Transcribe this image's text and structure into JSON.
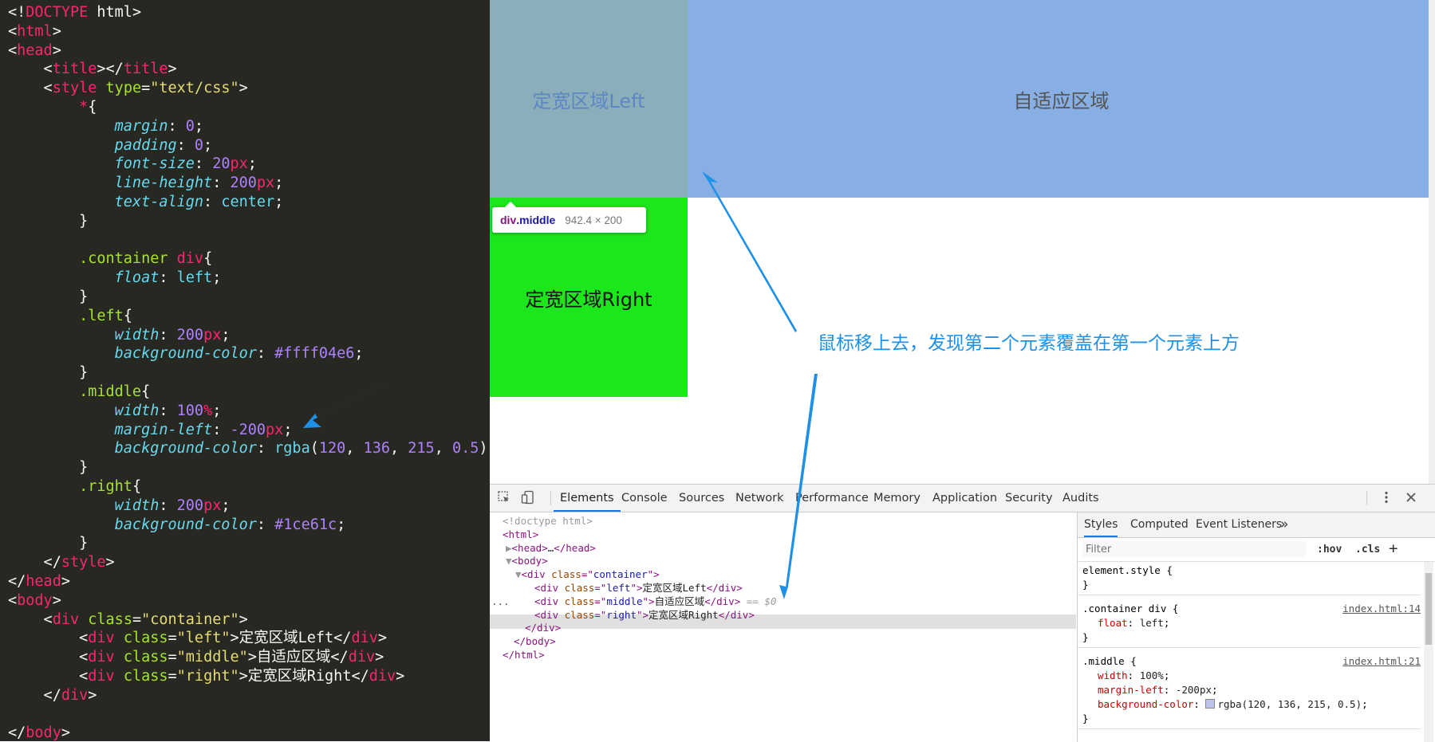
{
  "editor": {
    "lines": [
      [
        [
          "t-p",
          "<!"
        ],
        [
          "t-tag",
          "DOCTYPE"
        ],
        [
          "t-p",
          " html>"
        ]
      ],
      [
        [
          "t-p",
          "<"
        ],
        [
          "t-tag",
          "html"
        ],
        [
          "t-p",
          ">"
        ]
      ],
      [
        [
          "t-p",
          "<"
        ],
        [
          "t-tag",
          "head"
        ],
        [
          "t-p",
          ">"
        ]
      ],
      [
        [
          "t-p",
          "    <"
        ],
        [
          "t-tag",
          "title"
        ],
        [
          "t-p",
          "></"
        ],
        [
          "t-tag",
          "title"
        ],
        [
          "t-p",
          ">"
        ]
      ],
      [
        [
          "t-p",
          "    <"
        ],
        [
          "t-tag",
          "style"
        ],
        [
          "t-p",
          " "
        ],
        [
          "t-attr",
          "type"
        ],
        [
          "t-p",
          "="
        ],
        [
          "t-str",
          "\"text/css\""
        ],
        [
          "t-p",
          ">"
        ]
      ],
      [
        [
          "t-p",
          "        "
        ],
        [
          "t-tag",
          "*"
        ],
        [
          "t-p",
          "{"
        ]
      ],
      [
        [
          "t-p",
          "            "
        ],
        [
          "t-prop",
          "margin"
        ],
        [
          "t-p",
          ": "
        ],
        [
          "t-num",
          "0"
        ],
        [
          "t-p",
          ";"
        ]
      ],
      [
        [
          "t-p",
          "            "
        ],
        [
          "t-prop",
          "padding"
        ],
        [
          "t-p",
          ": "
        ],
        [
          "t-num",
          "0"
        ],
        [
          "t-p",
          ";"
        ]
      ],
      [
        [
          "t-p",
          "            "
        ],
        [
          "t-prop",
          "font-size"
        ],
        [
          "t-p",
          ": "
        ],
        [
          "t-num",
          "20"
        ],
        [
          "t-tag",
          "px"
        ],
        [
          "t-p",
          ";"
        ]
      ],
      [
        [
          "t-p",
          "            "
        ],
        [
          "t-prop",
          "line-height"
        ],
        [
          "t-p",
          ": "
        ],
        [
          "t-num",
          "200"
        ],
        [
          "t-tag",
          "px"
        ],
        [
          "t-p",
          ";"
        ]
      ],
      [
        [
          "t-p",
          "            "
        ],
        [
          "t-prop",
          "text-align"
        ],
        [
          "t-p",
          ": "
        ],
        [
          "t-kw",
          "center"
        ],
        [
          "t-p",
          ";"
        ]
      ],
      [
        [
          "t-p",
          "        }"
        ]
      ],
      [
        [
          "t-p",
          ""
        ]
      ],
      [
        [
          "t-p",
          "        "
        ],
        [
          "t-sel",
          ".container"
        ],
        [
          "t-p",
          " "
        ],
        [
          "t-tag",
          "div"
        ],
        [
          "t-p",
          "{"
        ]
      ],
      [
        [
          "t-p",
          "            "
        ],
        [
          "t-prop",
          "float"
        ],
        [
          "t-p",
          ": "
        ],
        [
          "t-kw",
          "left"
        ],
        [
          "t-p",
          ";"
        ]
      ],
      [
        [
          "t-p",
          "        }"
        ]
      ],
      [
        [
          "t-p",
          "        "
        ],
        [
          "t-sel",
          ".left"
        ],
        [
          "t-p",
          "{"
        ]
      ],
      [
        [
          "t-p",
          "            "
        ],
        [
          "t-prop",
          "width"
        ],
        [
          "t-p",
          ": "
        ],
        [
          "t-num",
          "200"
        ],
        [
          "t-tag",
          "px"
        ],
        [
          "t-p",
          ";"
        ]
      ],
      [
        [
          "t-p",
          "            "
        ],
        [
          "t-prop",
          "background-color"
        ],
        [
          "t-p",
          ": "
        ],
        [
          "t-num",
          "#ffff04e6"
        ],
        [
          "t-p",
          ";"
        ]
      ],
      [
        [
          "t-p",
          "        }"
        ]
      ],
      [
        [
          "t-p",
          "        "
        ],
        [
          "t-sel",
          ".middle"
        ],
        [
          "t-p",
          "{"
        ]
      ],
      [
        [
          "t-p",
          "            "
        ],
        [
          "t-prop",
          "width"
        ],
        [
          "t-p",
          ": "
        ],
        [
          "t-num",
          "100"
        ],
        [
          "t-tag",
          "%"
        ],
        [
          "t-p",
          ";"
        ]
      ],
      [
        [
          "t-p",
          "            "
        ],
        [
          "t-prop",
          "margin-left"
        ],
        [
          "t-p",
          ": "
        ],
        [
          "t-num",
          "-200"
        ],
        [
          "t-tag",
          "px"
        ],
        [
          "t-p",
          ";"
        ]
      ],
      [
        [
          "t-p",
          "            "
        ],
        [
          "t-prop",
          "background-color"
        ],
        [
          "t-p",
          ": "
        ],
        [
          "t-kw",
          "rgba"
        ],
        [
          "t-p",
          "("
        ],
        [
          "t-num",
          "120"
        ],
        [
          "t-p",
          ", "
        ],
        [
          "t-num",
          "136"
        ],
        [
          "t-p",
          ", "
        ],
        [
          "t-num",
          "215"
        ],
        [
          "t-p",
          ", "
        ],
        [
          "t-num",
          "0.5"
        ],
        [
          "t-p",
          ");"
        ]
      ],
      [
        [
          "t-p",
          "        }"
        ]
      ],
      [
        [
          "t-p",
          "        "
        ],
        [
          "t-sel",
          ".right"
        ],
        [
          "t-p",
          "{"
        ]
      ],
      [
        [
          "t-p",
          "            "
        ],
        [
          "t-prop",
          "width"
        ],
        [
          "t-p",
          ": "
        ],
        [
          "t-num",
          "200"
        ],
        [
          "t-tag",
          "px"
        ],
        [
          "t-p",
          ";"
        ]
      ],
      [
        [
          "t-p",
          "            "
        ],
        [
          "t-prop",
          "background-color"
        ],
        [
          "t-p",
          ": "
        ],
        [
          "t-num",
          "#1ce61c"
        ],
        [
          "t-p",
          ";"
        ]
      ],
      [
        [
          "t-p",
          "        }"
        ]
      ],
      [
        [
          "t-p",
          "    </"
        ],
        [
          "t-tag",
          "style"
        ],
        [
          "t-p",
          ">"
        ]
      ],
      [
        [
          "t-p",
          "</"
        ],
        [
          "t-tag",
          "head"
        ],
        [
          "t-p",
          ">"
        ]
      ],
      [
        [
          "t-p",
          "<"
        ],
        [
          "t-tag",
          "body"
        ],
        [
          "t-p",
          ">"
        ]
      ],
      [
        [
          "t-p",
          "    <"
        ],
        [
          "t-tag",
          "div"
        ],
        [
          "t-p",
          " "
        ],
        [
          "t-attr",
          "class"
        ],
        [
          "t-p",
          "="
        ],
        [
          "t-str",
          "\"container\""
        ],
        [
          "t-p",
          ">"
        ]
      ],
      [
        [
          "t-p",
          "        <"
        ],
        [
          "t-tag",
          "div"
        ],
        [
          "t-p",
          " "
        ],
        [
          "t-attr",
          "class"
        ],
        [
          "t-p",
          "="
        ],
        [
          "t-str",
          "\"left\""
        ],
        [
          "t-p",
          ">定宽区域Left</"
        ],
        [
          "t-tag",
          "div"
        ],
        [
          "t-p",
          ">"
        ]
      ],
      [
        [
          "t-p",
          "        <"
        ],
        [
          "t-tag",
          "div"
        ],
        [
          "t-p",
          " "
        ],
        [
          "t-attr",
          "class"
        ],
        [
          "t-p",
          "="
        ],
        [
          "t-str",
          "\"middle\""
        ],
        [
          "t-p",
          ">自适应区域</"
        ],
        [
          "t-tag",
          "div"
        ],
        [
          "t-p",
          ">"
        ]
      ],
      [
        [
          "t-p",
          "        <"
        ],
        [
          "t-tag",
          "div"
        ],
        [
          "t-p",
          " "
        ],
        [
          "t-attr",
          "class"
        ],
        [
          "t-p",
          "="
        ],
        [
          "t-str",
          "\"right\""
        ],
        [
          "t-p",
          ">定宽区域Right</"
        ],
        [
          "t-tag",
          "div"
        ],
        [
          "t-p",
          ">"
        ]
      ],
      [
        [
          "t-p",
          "    </"
        ],
        [
          "t-tag",
          "div"
        ],
        [
          "t-p",
          ">"
        ]
      ],
      [
        [
          "t-p",
          ""
        ]
      ],
      [
        [
          "t-p",
          "</"
        ],
        [
          "t-tag",
          "body"
        ],
        [
          "t-p",
          ">"
        ]
      ]
    ]
  },
  "preview": {
    "left_label": "定宽区域Left",
    "middle_label": "自适应区域",
    "right_label": "定宽区域Right",
    "tooltip_tag": "div",
    "tooltip_class": ".middle",
    "tooltip_size": "942.4 × 200",
    "annotation": "鼠标移上去，发现第二个元素覆盖在第一个元素上方",
    "colors": {
      "left": "#8aafba",
      "middle": "#87afe3",
      "right": "#1ce61c",
      "annotation": "#1e90e8"
    }
  },
  "devtools": {
    "tabs": [
      "Elements",
      "Console",
      "Sources",
      "Network",
      "Performance",
      "Memory",
      "Application",
      "Security",
      "Audits"
    ],
    "active_tab": "Elements",
    "icons": [
      "inspect-icon",
      "device-toggle-icon",
      "more-vert-icon",
      "close-icon"
    ],
    "dom": [
      [
        [
          "c-gray",
          "<!doctype html>"
        ]
      ],
      [
        [
          "c-tag",
          "<html>"
        ]
      ],
      [
        [
          "c-gray",
          "▶"
        ],
        [
          "c-tag",
          "<head>"
        ],
        [
          "c-txt",
          "…"
        ],
        [
          "c-tag",
          "</head>"
        ]
      ],
      [
        [
          "c-gray",
          "▼"
        ],
        [
          "c-tag",
          "<body>"
        ]
      ],
      [
        [
          "c-gray",
          "▼"
        ],
        [
          "c-tag",
          "<div "
        ],
        [
          "c-attr",
          "class"
        ],
        [
          "c-tag",
          "=\""
        ],
        [
          "c-val",
          "container"
        ],
        [
          "c-tag",
          "\">"
        ]
      ],
      [
        [
          "c-tag",
          "<div "
        ],
        [
          "c-attr",
          "class"
        ],
        [
          "c-tag",
          "=\""
        ],
        [
          "c-val",
          "left"
        ],
        [
          "c-tag",
          "\">"
        ],
        [
          "c-txt",
          "定宽区域Left"
        ],
        [
          "c-tag",
          "</div>"
        ]
      ],
      [
        [
          "c-tag",
          "<div "
        ],
        [
          "c-attr",
          "class"
        ],
        [
          "c-tag",
          "=\""
        ],
        [
          "c-val",
          "middle"
        ],
        [
          "c-tag",
          "\">"
        ],
        [
          "c-txt",
          "自适应区域"
        ],
        [
          "c-tag",
          "</div>"
        ],
        [
          "c-com",
          " == $0"
        ]
      ],
      [
        [
          "c-tag",
          "<div "
        ],
        [
          "c-attr",
          "class"
        ],
        [
          "c-tag",
          "=\""
        ],
        [
          "c-val",
          "right"
        ],
        [
          "c-tag",
          "\">"
        ],
        [
          "c-txt",
          "定宽区域Right"
        ],
        [
          "c-tag",
          "</div>"
        ]
      ],
      [
        [
          "c-tag",
          "</div>"
        ]
      ],
      [
        [
          "c-tag",
          "</body>"
        ]
      ],
      [
        [
          "c-tag",
          "</html>"
        ]
      ]
    ],
    "selected_dots": "...",
    "styles_tabs": [
      "Styles",
      "Computed",
      "Event Listeners"
    ],
    "styles_more": "»",
    "filter_placeholder": "Filter",
    "hov": ":hov",
    "cls": ".cls",
    "plus": "+",
    "rules": [
      {
        "selector": "element.style {",
        "source": "",
        "props": [],
        "close": "}"
      },
      {
        "selector": ".container div {",
        "source": "index.html:14",
        "props": [
          [
            "float",
            "left"
          ]
        ],
        "close": "}"
      },
      {
        "selector": ".middle {",
        "source": "index.html:21",
        "props": [
          [
            "width",
            "100%"
          ],
          [
            "margin-left",
            "-200px"
          ],
          [
            "background-color",
            "rgba(120, 136, 215, 0.5)"
          ]
        ],
        "close": "}"
      }
    ]
  }
}
